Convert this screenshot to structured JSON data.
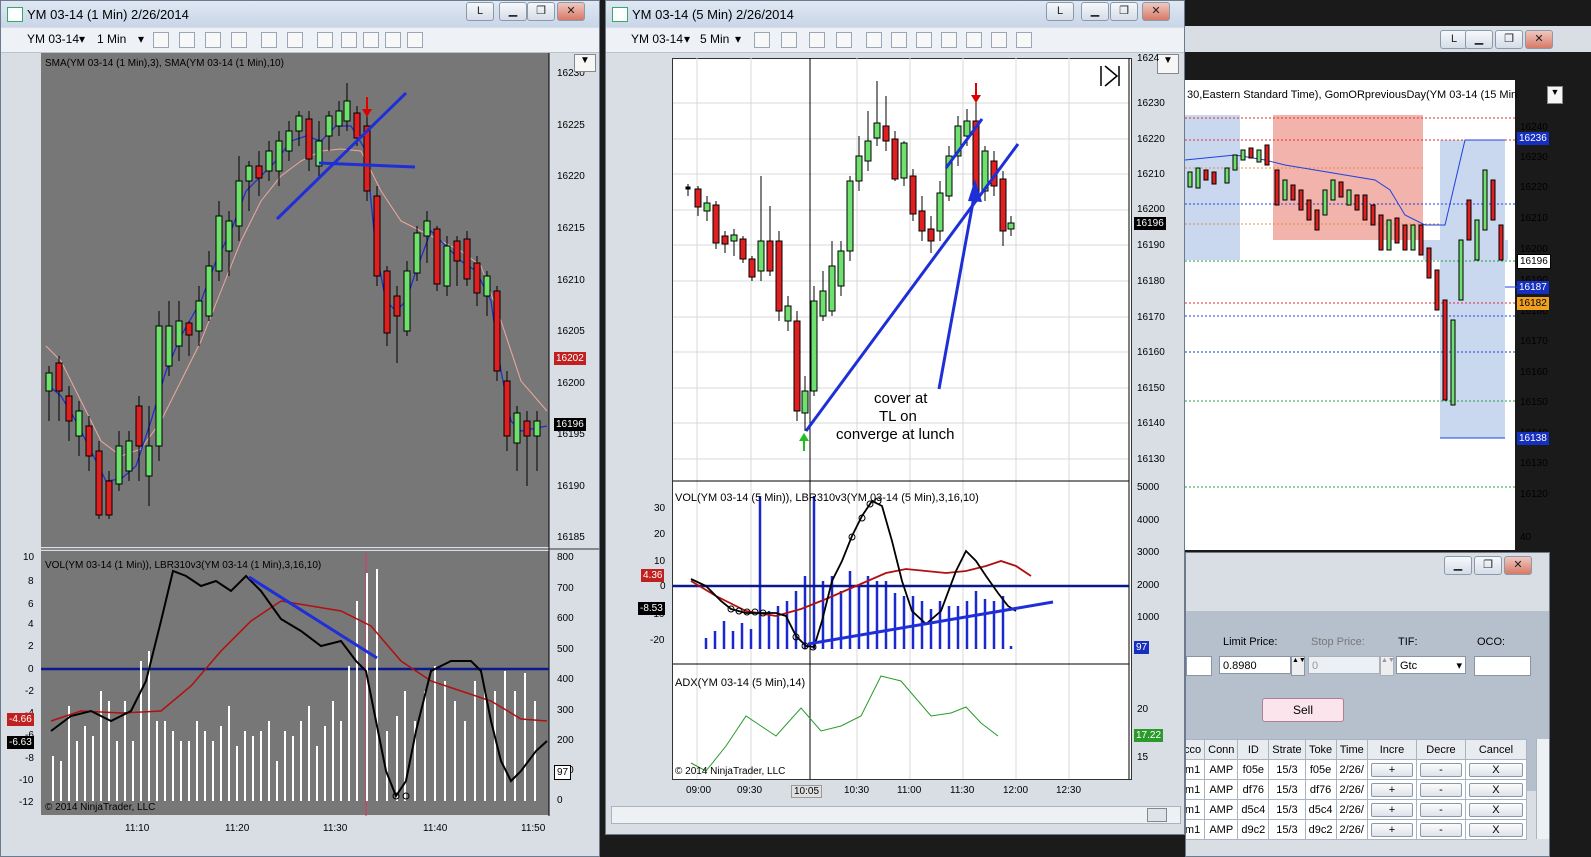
{
  "w1": {
    "title": "YM 03-14 (1 Min)  2/26/2014",
    "instrument": "YM 03-14",
    "interval": "1 Min",
    "indicator_label": "SMA(YM 03-14 (1 Min),3), SMA(YM 03-14 (1 Min),10)",
    "panel2_label": "VOL(YM 03-14 (1 Min)), LBR310v3(YM 03-14 (1 Min),3,16,10)",
    "copyright": "© 2014 NinjaTrader, LLC",
    "price_ticks": [
      "16230",
      "16225",
      "16220",
      "16215",
      "16210",
      "16205",
      "16200",
      "16195",
      "16190",
      "16185"
    ],
    "price_tag": "16202",
    "last_tag": "16196",
    "osc_ticks": [
      "10",
      "8",
      "6",
      "4",
      "2",
      "0",
      "-2",
      "-4",
      "-6",
      "-8",
      "-10",
      "-12"
    ],
    "vol_ticks": [
      "800",
      "700",
      "600",
      "500",
      "400",
      "300",
      "200",
      "100",
      "0"
    ],
    "osc_tag1": "-4.66",
    "osc_tag2": "-6.63",
    "vol_tag": "97",
    "time_ticks": [
      "11:10",
      "11:20",
      "11:30",
      "11:40",
      "11:50"
    ],
    "btn_l": "L"
  },
  "w2": {
    "title": "YM 03-14 (5 Min)  2/26/2014",
    "instrument": "YM 03-14",
    "interval": "5 Min",
    "price_ticks": [
      "16230",
      "16220",
      "16210",
      "16200",
      "16190",
      "16180",
      "16170",
      "16160",
      "16150",
      "16140",
      "16130"
    ],
    "price_top": "1624",
    "last_tag": "16196",
    "annotation": [
      "cover at",
      "TL  on",
      "converge at lunch"
    ],
    "panel2_label": "VOL(YM 03-14 (5 Min)), LBR310v3(YM 03-14 (5 Min),3,16,10)",
    "osc_ticks": [
      "30",
      "20",
      "10",
      "0",
      "-10",
      "-20"
    ],
    "vol_ticks": [
      "5000",
      "4000",
      "3000",
      "2000",
      "1000"
    ],
    "osc_tag1": "4.36",
    "osc_tag2": "-8.53",
    "vol_tag": "97",
    "panel3_label": "ADX(YM 03-14 (5 Min),14)",
    "adx_ticks": [
      "20",
      "15"
    ],
    "adx_tag": "17.22",
    "copyright": "© 2014 NinjaTrader, LLC",
    "time_ticks": [
      "09:00",
      "09:30",
      "10:05",
      "10:30",
      "11:00",
      "11:30",
      "12:00",
      "12:30"
    ],
    "btn_l": "L"
  },
  "w3": {
    "title": "30,Eastern Standard Time), GomORpreviousDay(YM 03-14 (15 Min",
    "price_ticks": [
      "16240",
      "16230",
      "16220",
      "16210",
      "16200",
      "16190",
      "16180",
      "16170",
      "16160",
      "16150",
      "16140",
      "16130",
      "16120"
    ],
    "tags": {
      "top": "16236",
      "last": "16196",
      "blue1": "16187",
      "orange": "16182",
      "blue2": "16138"
    },
    "bottom_tick": "40",
    "btn_l": "L"
  },
  "order": {
    "limit_price_label": "Limit Price:",
    "stop_price_label": "Stop Price:",
    "tif_label": "TIF:",
    "oco_label": "OCO:",
    "limit_price": "0.8980",
    "stop_price": "0",
    "tif": "Gtc",
    "sell": "Sell",
    "columns": [
      "cco",
      "Conn",
      "ID",
      "Strate",
      "Toke",
      "Time",
      "Incre",
      "Decre",
      "Cancel"
    ],
    "rows": [
      {
        "cco": "m1",
        "conn": "AMP",
        "id": "f05e",
        "strat": "15/3",
        "toke": "f05e",
        "time": "2/26/",
        "inc": "+",
        "dec": "-",
        "cancel": "X"
      },
      {
        "cco": "m1",
        "conn": "AMP",
        "id": "df76",
        "strat": "15/3",
        "toke": "df76",
        "time": "2/26/",
        "inc": "+",
        "dec": "-",
        "cancel": "X"
      },
      {
        "cco": "m1",
        "conn": "AMP",
        "id": "d5c4",
        "strat": "15/3",
        "toke": "d5c4",
        "time": "2/26/",
        "inc": "+",
        "dec": "-",
        "cancel": "X"
      },
      {
        "cco": "m1",
        "conn": "AMP",
        "id": "d9c2",
        "strat": "15/3",
        "toke": "d9c2",
        "time": "2/26/",
        "inc": "+",
        "dec": "-",
        "cancel": "X"
      }
    ]
  }
}
